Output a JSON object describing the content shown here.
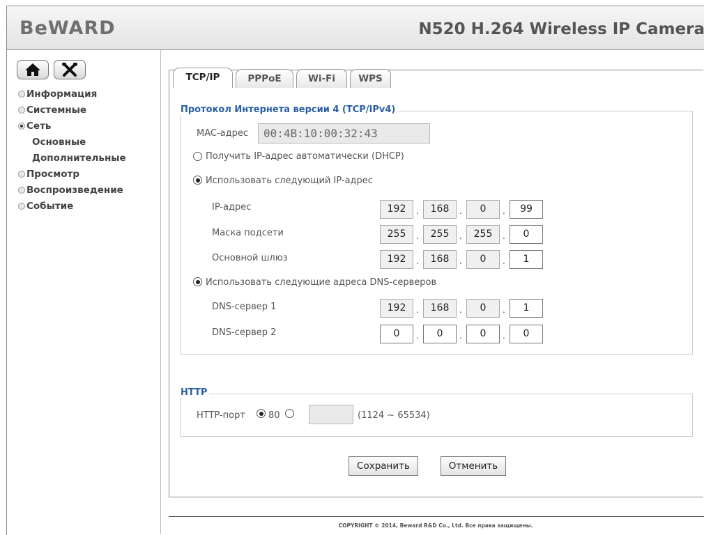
{
  "header": {
    "logo_text": "BeWARD",
    "product_title": "N520 H.264 Wireless IP Camera"
  },
  "sidebar": {
    "home_icon": "home-icon",
    "settings_icon": "tools-icon",
    "items": [
      {
        "label": "Информация",
        "selected": false
      },
      {
        "label": "Системные",
        "selected": false
      },
      {
        "label": "Сеть",
        "selected": true
      },
      {
        "label": "Основные"
      },
      {
        "label": "Дополнительные"
      },
      {
        "label": "Просмотр",
        "selected": false
      },
      {
        "label": "Воспроизведение",
        "selected": false
      },
      {
        "label": "Событие",
        "selected": false
      }
    ]
  },
  "tabs": [
    {
      "label": "TCP/IP",
      "active": true
    },
    {
      "label": "PPPoE",
      "active": false
    },
    {
      "label": "Wi-Fi",
      "active": false
    },
    {
      "label": "WPS",
      "active": false
    }
  ],
  "ipv4": {
    "legend": "Протокол Интернета версии 4 (TCP/IPv4)",
    "mac_label": "MAC-адрес",
    "mac_value": "00:4B:10:00:32:43",
    "dhcp_label": "Получить IP-адрес автоматически (DHCP)",
    "dhcp_selected": false,
    "static_label": "Использовать следующий IP-адрес",
    "static_selected": true,
    "ip_label": "IP-адрес",
    "ip": [
      "192",
      "168",
      "0",
      "99"
    ],
    "mask_label": "Маска подсети",
    "mask": [
      "255",
      "255",
      "255",
      "0"
    ],
    "gateway_label": "Основной шлюз",
    "gateway": [
      "192",
      "168",
      "0",
      "1"
    ],
    "dns_static_label": "Использовать следующие адреса DNS-серверов",
    "dns_static_selected": true,
    "dns1_label": "DNS-сервер 1",
    "dns1": [
      "192",
      "168",
      "0",
      "1"
    ],
    "dns2_label": "DNS-сервер 2",
    "dns2": [
      "0",
      "0",
      "0",
      "0"
    ]
  },
  "http": {
    "legend": "HTTP",
    "port_label": "HTTP-порт",
    "default_port": "80",
    "default_selected": true,
    "custom_port_value": "",
    "range_hint": "(1124 ~ 65534)"
  },
  "actions": {
    "save": "Сохранить",
    "cancel": "Отменить"
  },
  "footer": {
    "copyright": "COPYRIGHT © 2014, Beward R&D Co., Ltd. Все права защищены."
  }
}
